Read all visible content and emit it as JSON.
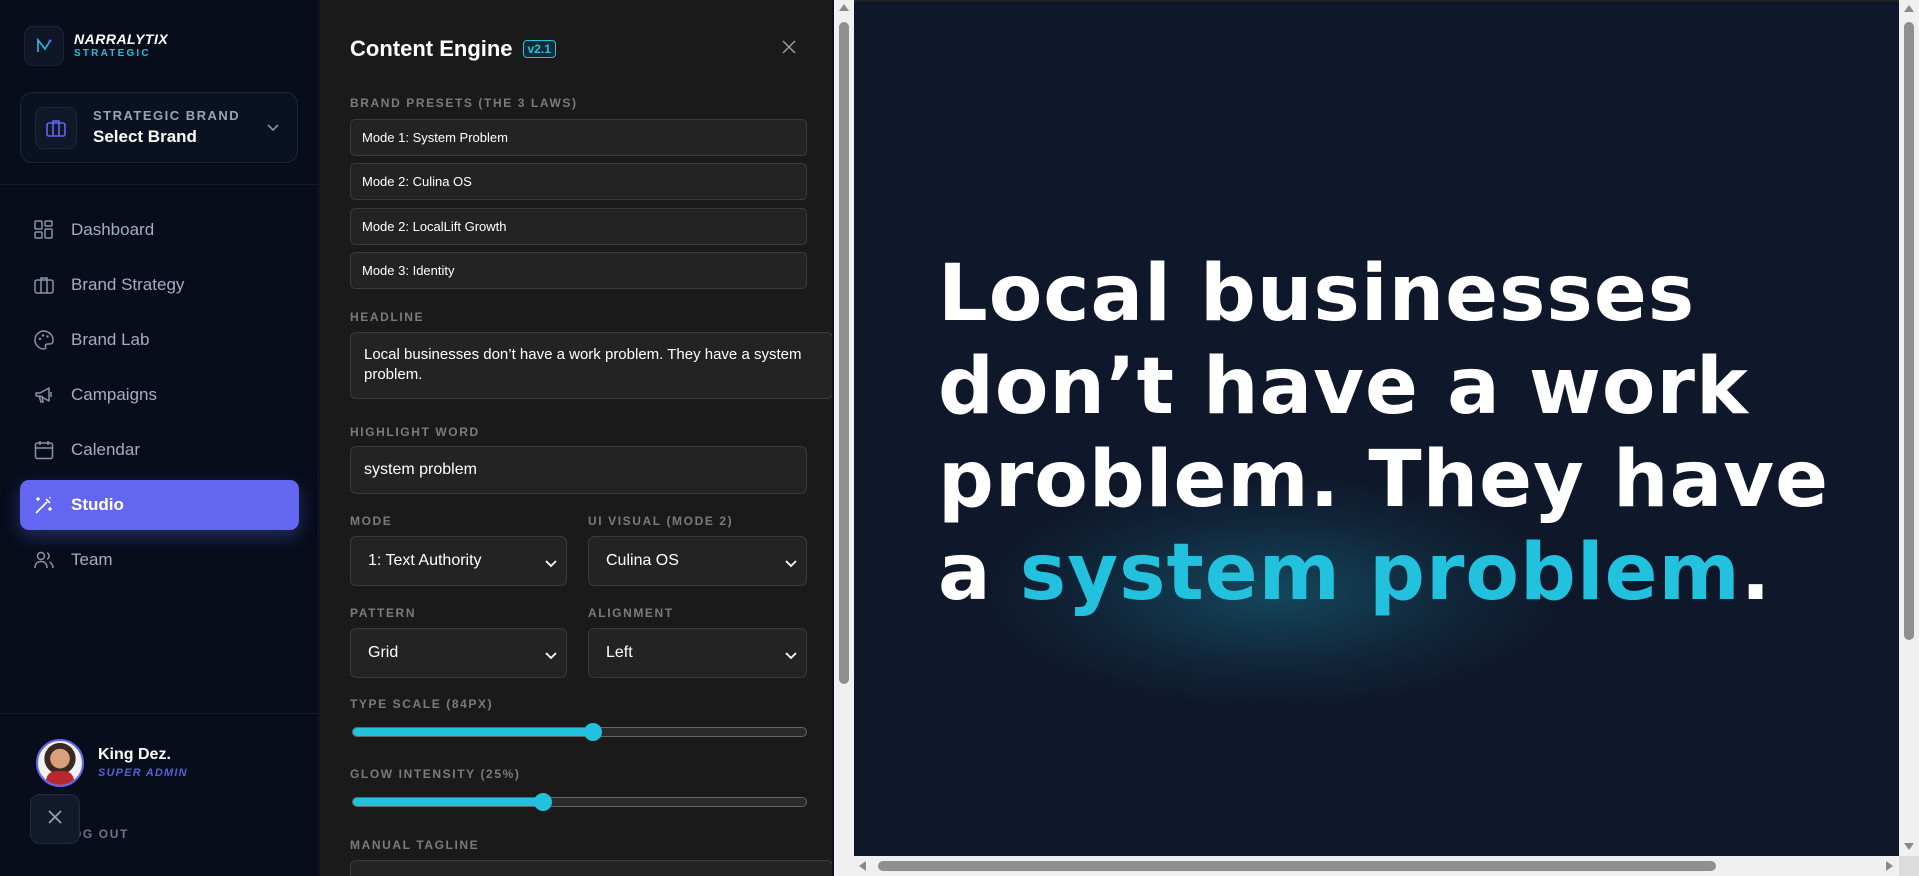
{
  "app": {
    "logo_name": "NARRALYTIX",
    "logo_sub": "STRATEGIC"
  },
  "brand_selector": {
    "label": "STRATEGIC BRAND",
    "value": "Select Brand"
  },
  "nav": {
    "items": [
      {
        "label": "Dashboard",
        "icon": "dashboard-icon"
      },
      {
        "label": "Brand Strategy",
        "icon": "briefcase-icon"
      },
      {
        "label": "Brand Lab",
        "icon": "palette-icon"
      },
      {
        "label": "Campaigns",
        "icon": "megaphone-icon"
      },
      {
        "label": "Calendar",
        "icon": "calendar-icon"
      },
      {
        "label": "Studio",
        "icon": "magic-wand-icon",
        "active": true
      },
      {
        "label": "Team",
        "icon": "users-icon"
      }
    ]
  },
  "user": {
    "name": "King Dez.",
    "role": "SUPER ADMIN",
    "logout": "OG OUT"
  },
  "panel": {
    "title": "Content Engine",
    "version": "v2.1",
    "presets_label": "BRAND PRESETS (THE 3 LAWS)",
    "presets": [
      "Mode 1: System Problem",
      "Mode 2: Culina OS",
      "Mode 2: LocalLift Growth",
      "Mode 3: Identity"
    ],
    "headline_label": "HEADLINE",
    "headline_value": "Local businesses don’t have a work problem. They have a system problem.",
    "highlight_label": "HIGHLIGHT WORD",
    "highlight_value": "system problem",
    "mode_label": "MODE",
    "mode_value": "1: Text Authority",
    "ui_visual_label": "UI VISUAL (MODE 2)",
    "ui_visual_value": "Culina OS",
    "pattern_label": "PATTERN",
    "pattern_value": "Grid",
    "alignment_label": "ALIGNMENT",
    "alignment_value": "Left",
    "type_scale_label": "TYPE SCALE (84PX)",
    "type_scale_fraction": 0.53,
    "glow_label": "GLOW INTENSITY (25%)",
    "glow_fraction": 0.42,
    "tagline_label": "MANUAL TAGLINE"
  },
  "preview": {
    "headline_before": "Local businesses don’t have a work problem. They have a ",
    "headline_highlight": "system problem",
    "headline_after": "."
  },
  "colors": {
    "accent": "#6366f1",
    "highlight": "#22c1dd",
    "preview_bg": "#0f172a",
    "panel_bg": "#1a1a1a",
    "sidebar_bg": "#070d1b"
  }
}
